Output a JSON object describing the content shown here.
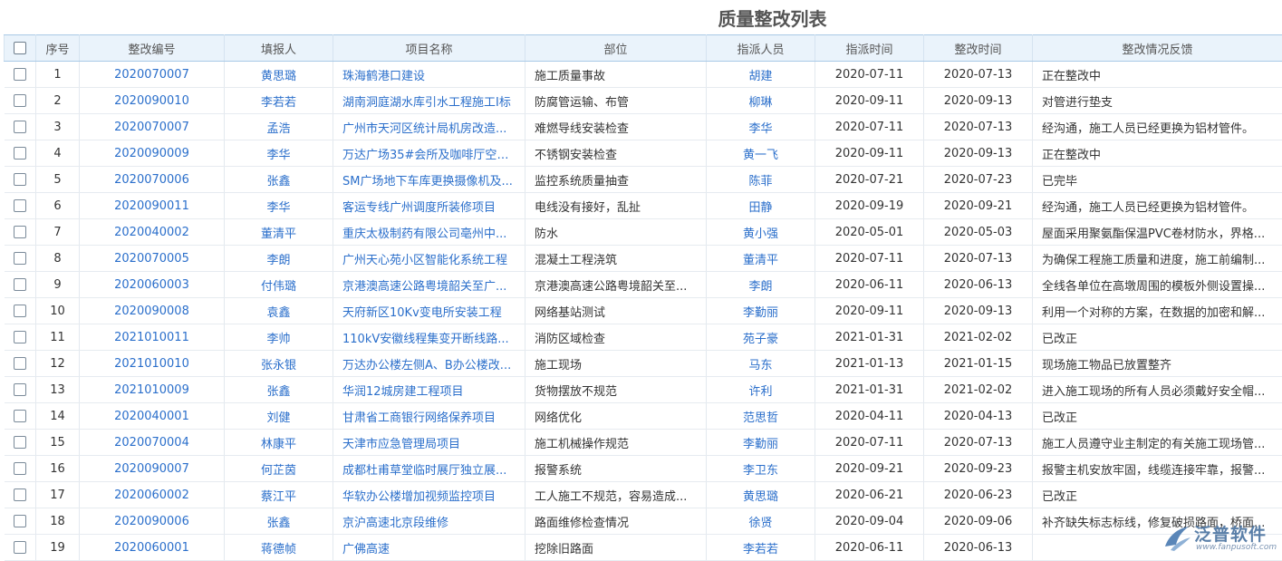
{
  "page": {
    "title": "质量整改列表"
  },
  "table": {
    "headers": [
      "序号",
      "整改编号",
      "填报人",
      "项目名称",
      "部位",
      "指派人员",
      "指派时间",
      "整改时间",
      "整改情况反馈"
    ],
    "rows": [
      [
        "1",
        "2020070007",
        "黄思璐",
        "珠海鹤港口建设",
        "施工质量事故",
        "胡建",
        "2020-07-11",
        "2020-07-13",
        "正在整改中"
      ],
      [
        "2",
        "2020090010",
        "李若若",
        "湖南洞庭湖水库引水工程施工Ⅰ标",
        "防腐管运输、布管",
        "柳琳",
        "2020-09-11",
        "2020-09-13",
        "对管进行垫支"
      ],
      [
        "3",
        "2020070007",
        "孟浩",
        "广州市天河区统计局机房改造...",
        "难燃导线安装检查",
        "李华",
        "2020-07-11",
        "2020-07-13",
        "经沟通，施工人员已经更换为铝材管件。"
      ],
      [
        "4",
        "2020090009",
        "李华",
        "万达广场35#会所及咖啡厅空调...",
        "不锈钢安装检查",
        "黄一飞",
        "2020-09-11",
        "2020-09-13",
        "正在整改中"
      ],
      [
        "5",
        "2020070006",
        "张鑫",
        "SM广场地下车库更换摄像机及...",
        "监控系统质量抽查",
        "陈菲",
        "2020-07-21",
        "2020-07-23",
        "已完毕"
      ],
      [
        "6",
        "2020090011",
        "李华",
        "客运专线广州调度所装修项目",
        "电线没有接好，乱扯",
        "田静",
        "2020-09-19",
        "2020-09-21",
        "经沟通，施工人员已经更换为铝材管件。"
      ],
      [
        "7",
        "2020040002",
        "董清平",
        "重庆太极制药有限公司亳州中...",
        "防水",
        "黄小强",
        "2020-05-01",
        "2020-05-03",
        "屋面采用聚氨酯保温PVC卷材防水，界格..."
      ],
      [
        "8",
        "2020070005",
        "李朗",
        "广州天心苑小区智能化系统工程",
        "混凝土工程浇筑",
        "董清平",
        "2020-07-11",
        "2020-07-13",
        "为确保工程施工质量和进度，施工前编制..."
      ],
      [
        "9",
        "2020060003",
        "付伟璐",
        "京港澳高速公路粤境韶关至广...",
        "京港澳高速公路粤境韶关至...",
        "李朗",
        "2020-06-11",
        "2020-06-13",
        "全线各单位在高墩周围的模板外侧设置操..."
      ],
      [
        "10",
        "2020090008",
        "袁鑫",
        "天府新区10Kv变电所安装工程",
        "网络基站测试",
        "李勤丽",
        "2020-09-11",
        "2020-09-13",
        "利用一个对称的方案，在数据的加密和解..."
      ],
      [
        "11",
        "2021010011",
        "李帅",
        "110kV安徽线程集变开断线路...",
        "消防区域检查",
        "苑子豪",
        "2021-01-31",
        "2021-02-02",
        "已改正"
      ],
      [
        "12",
        "2021010010",
        "张永银",
        "万达办公楼左侧A、B办公楼改...",
        "施工现场",
        "马东",
        "2021-01-13",
        "2021-01-15",
        "现场施工物品已放置整齐"
      ],
      [
        "13",
        "2021010009",
        "张鑫",
        "华润12城房建工程项目",
        "货物摆放不规范",
        "许利",
        "2021-01-31",
        "2021-02-02",
        "进入施工现场的所有人员必须戴好安全帽..."
      ],
      [
        "14",
        "2020040001",
        "刘健",
        "甘肃省工商银行网络保养项目",
        "网络优化",
        "范思哲",
        "2020-04-11",
        "2020-04-13",
        "已改正"
      ],
      [
        "15",
        "2020070004",
        "林康平",
        "天津市应急管理局项目",
        "施工机械操作规范",
        "李勤丽",
        "2020-07-11",
        "2020-07-13",
        "施工人员遵守业主制定的有关施工现场管..."
      ],
      [
        "16",
        "2020090007",
        "何芷茵",
        "成都杜甫草堂临时展厅独立展...",
        "报警系统",
        "李卫东",
        "2020-09-21",
        "2020-09-23",
        "报警主机安放牢固，线缆连接牢靠，报警..."
      ],
      [
        "17",
        "2020060002",
        "蔡江平",
        "华软办公楼增加视频监控项目",
        "工人施工不规范，容易造成...",
        "黄思璐",
        "2020-06-21",
        "2020-06-23",
        "已改正"
      ],
      [
        "18",
        "2020090006",
        "张鑫",
        "京沪高速北京段维修",
        "路面维修检查情况",
        "徐贤",
        "2020-09-04",
        "2020-09-06",
        "补齐缺失标志标线，修复破损路面，桥面..."
      ],
      [
        "19",
        "2020060001",
        "蒋德帧",
        "广佛高速",
        "挖除旧路面",
        "李若若",
        "2020-06-11",
        "2020-06-13",
        ""
      ]
    ]
  },
  "watermark": {
    "brand": "泛普软件",
    "url": "www.fanpusoft.com"
  },
  "colors": {
    "link": "#2b6fcb",
    "header_bg": "#eaf3fb",
    "border": "#a9c9e6"
  }
}
